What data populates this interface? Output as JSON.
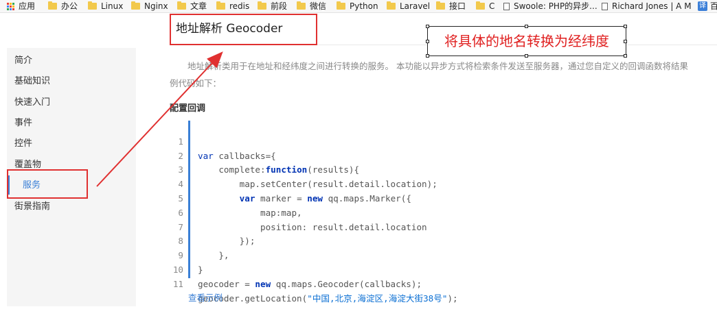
{
  "bookmarks": [
    {
      "label": "应用",
      "icon": "apps-grid-icon"
    },
    {
      "label": "办公",
      "icon": "folder-icon"
    },
    {
      "label": "Linux",
      "icon": "folder-icon"
    },
    {
      "label": "Nginx",
      "icon": "folder-icon"
    },
    {
      "label": "文章",
      "icon": "folder-icon"
    },
    {
      "label": "redis",
      "icon": "folder-icon"
    },
    {
      "label": "前段",
      "icon": "folder-icon"
    },
    {
      "label": "微信",
      "icon": "folder-icon"
    },
    {
      "label": "Python",
      "icon": "folder-icon"
    },
    {
      "label": "Laravel",
      "icon": "folder-icon"
    },
    {
      "label": "接口",
      "icon": "folder-icon"
    },
    {
      "label": "C",
      "icon": "folder-icon"
    },
    {
      "label": "Swoole: PHP的异步...",
      "icon": "page-icon"
    },
    {
      "label": "Richard Jones | A M",
      "icon": "page-icon"
    },
    {
      "label": "百",
      "icon": "translate-icon"
    }
  ],
  "sidebar": {
    "items": [
      {
        "label": "简介"
      },
      {
        "label": "基础知识"
      },
      {
        "label": "快速入门"
      },
      {
        "label": "事件"
      },
      {
        "label": "控件"
      },
      {
        "label": "覆盖物"
      },
      {
        "label": "服务",
        "active": true
      },
      {
        "label": "街景指南"
      }
    ]
  },
  "main": {
    "title": "地址解析 Geocoder",
    "intro_line1": "地址解析类用于在地址和经纬度之间进行转换的服务。 本功能以异步方式将检索条件发送至服务器，通过您自定义的回调函数将结果",
    "intro_line2": "例代码如下：",
    "section_title": "配置回调",
    "demo_link": "查看示例"
  },
  "code": {
    "line_numbers": [
      "1",
      "2",
      "3",
      "4",
      "5",
      "6",
      "7",
      "8",
      "9",
      "10",
      "11"
    ],
    "l1a": "var",
    "l1b": " callbacks={",
    "l2a": "    complete:",
    "l2b": "function",
    "l2c": "(results){",
    "l3": "        map.setCenter(result.detail.location);",
    "l4a": "        ",
    "l4b": "var",
    "l4c": " marker = ",
    "l4d": "new",
    "l4e": " qq.maps.Marker({",
    "l5": "            map:map,",
    "l6": "            position: result.detail.location",
    "l7": "        });",
    "l8": "    },",
    "l9": "}",
    "l10a": "geocoder = ",
    "l10b": "new",
    "l10c": " qq.maps.Geocoder(callbacks);",
    "l11a": "geocoder.getLocation(",
    "l11b": "\"中国,北京,海淀区,海淀大街38号\"",
    "l11c": ");"
  },
  "annotation": {
    "callout_text": "将具体的地名转换为经纬度"
  },
  "colors": {
    "accent": "#3a7fd6",
    "annotation_red": "#e03030"
  }
}
